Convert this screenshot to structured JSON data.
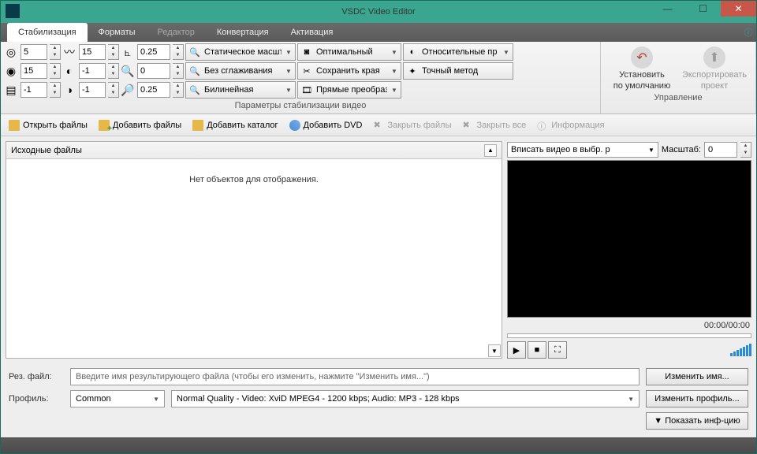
{
  "title": "VSDC Video Editor",
  "tabs": {
    "stab": "Стабилизация",
    "formats": "Форматы",
    "editor": "Редактор",
    "convert": "Конвертация",
    "activate": "Активация"
  },
  "spinners": {
    "r1c1": "5",
    "r2c1": "15",
    "r3c1": "-1",
    "r1c2": "15",
    "r2c2": "-1",
    "r3c2": "-1",
    "r1c3": "0.25",
    "r2c3": "0",
    "r3c3": "0.25"
  },
  "combos": {
    "c1r1": "Статическое масшт",
    "c1r2": "Без сглаживания",
    "c1r3": "Билинейная",
    "c2r1": "Оптимальный",
    "c2r2": "Сохранить края",
    "c2r3": "Прямые преобраз",
    "c3r1": "Относительные пр",
    "c3r2": "Точный метод"
  },
  "group_labels": {
    "params": "Параметры стабилизации видео",
    "manage": "Управление"
  },
  "big": {
    "reset1": "Установить",
    "reset2": "по умолчанию",
    "export1": "Экспортировать",
    "export2": "проект"
  },
  "toolbar": {
    "open": "Открыть файлы",
    "addfiles": "Добавить файлы",
    "adddir": "Добавить каталог",
    "adddvd": "Добавить DVD",
    "close": "Закрыть файлы",
    "closeall": "Закрыть все",
    "info": "Информация"
  },
  "source": {
    "title": "Исходные файлы",
    "empty": "Нет объектов для отображения."
  },
  "preview": {
    "fit": "Вписать видео в выбр. р",
    "zoom_label": "Масштаб:",
    "zoom": "0",
    "time": "00:00/00:00"
  },
  "bottom": {
    "resfile_label": "Рез. файл:",
    "resfile_placeholder": "Введите имя результирующего файла (чтобы его изменить, нажмите \"Изменить имя...\")",
    "profile_label": "Профиль:",
    "profile_sel": "Common",
    "profile_detail": "Normal Quality - Video: XviD MPEG4 - 1200 kbps; Audio: MP3 - 128 kbps",
    "change_name": "Изменить имя...",
    "change_profile": "Изменить профиль...",
    "show_info": "▼ Показать инф-цию"
  }
}
